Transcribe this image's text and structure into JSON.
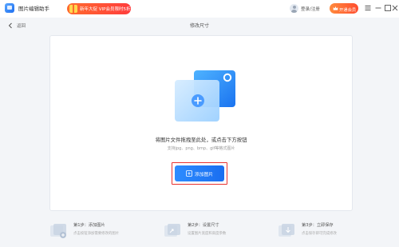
{
  "app": {
    "title": "图片编辑助手"
  },
  "promo": {
    "text": "新年大促 VIP会员限时5折"
  },
  "header": {
    "login_label": "登录/注册",
    "vip_label": "开通会员"
  },
  "nav": {
    "back_label": "返回"
  },
  "page": {
    "title": "修改尺寸"
  },
  "dropzone": {
    "main_text": "将图片文件拖拽至此处，或点击下方按钮",
    "sub_text": "支持jpg、png、bmp、gif等格式图片",
    "add_button_label": "添加图片"
  },
  "steps": [
    {
      "title": "第1步：添加图片",
      "desc": "点击按钮添加需要修改的图片"
    },
    {
      "title": "第2步：设置尺寸",
      "desc": "设置图片宽度和高度参数"
    },
    {
      "title": "第3步：立即保存",
      "desc": "点击保存即可完成修改"
    }
  ],
  "colors": {
    "accent": "#1a6ef0",
    "highlight": "#e8312f",
    "promo": "#ff4d2e"
  },
  "icons": [
    "app-logo-icon",
    "gift-icon",
    "avatar",
    "crown-icon",
    "menu-icon",
    "minimize-icon",
    "maximize-icon",
    "close-icon",
    "back-arrow-icon",
    "image-folder-illustration",
    "plus-icon"
  ]
}
